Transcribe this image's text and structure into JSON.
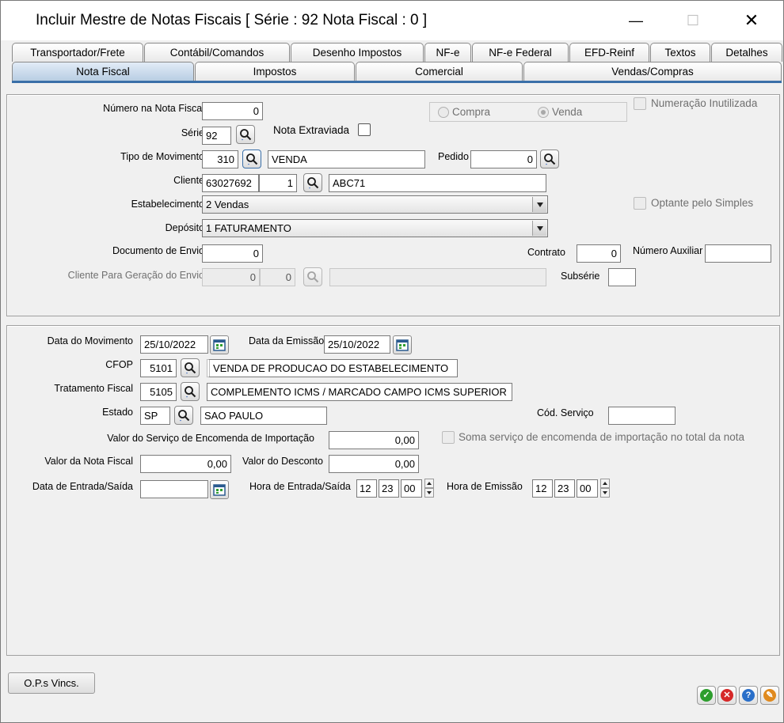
{
  "window": {
    "title": "Incluir Mestre de Notas Fiscais [ Série : 92 Nota Fiscal : 0 ]",
    "min_glyph": "—",
    "max_glyph": "☐",
    "close_glyph": "✕"
  },
  "tabs_row1": [
    "Transportador/Frete",
    "Contábil/Comandos",
    "Desenho Impostos",
    "NF-e",
    "NF-e Federal",
    "EFD-Reinf",
    "Textos",
    "Detalhes"
  ],
  "tabs_row2": [
    "Nota Fiscal",
    "Impostos",
    "Comercial",
    "Vendas/Compras"
  ],
  "active_tab": "Nota Fiscal",
  "top": {
    "numero_label": "Número na Nota Fiscal",
    "numero_value": "0",
    "serie_label": "Série",
    "serie_value": "92",
    "nota_extraviada_label": "Nota Extraviada",
    "tipo_mov_label": "Tipo de Movimento",
    "tipo_mov_code": "310",
    "tipo_mov_desc": "VENDA",
    "pedido_label": "Pedido",
    "pedido_value": "0",
    "cliente_label": "Cliente",
    "cliente_code": "63027692",
    "cliente_seq": "1",
    "cliente_name": "ABC71",
    "estab_label": "Estabelecimento",
    "estab_value": "2 Vendas",
    "deposito_label": "Depósito",
    "deposito_value": "1 FATURAMENTO",
    "doc_envio_label": "Documento de Envio",
    "doc_envio_value": "0",
    "contrato_label": "Contrato",
    "contrato_value": "0",
    "num_aux_label": "Número Auxiliar",
    "num_aux_value": "",
    "cliente_ger_label": "Cliente Para Geração do Envio",
    "cliente_ger_code": "0",
    "cliente_ger_seq": "0",
    "cliente_ger_name": "",
    "subserie_label": "Subsérie",
    "subserie_value": "",
    "compra_label": "Compra",
    "venda_label": "Venda",
    "selected_radio": "Venda",
    "num_inutilizada_label": "Numeração Inutilizada",
    "optante_label": "Optante pelo Simples"
  },
  "bottom": {
    "data_mov_label": "Data do Movimento",
    "data_mov_value": "25/10/2022",
    "data_emissao_label": "Data da Emissão",
    "data_emissao_value": "25/10/2022",
    "cfop_label": "CFOP",
    "cfop_code": "5101",
    "cfop_desc": "VENDA DE PRODUCAO DO ESTABELECIMENTO",
    "trat_label": "Tratamento Fiscal",
    "trat_code": "5105",
    "trat_desc": "COMPLEMENTO ICMS / MARCADO CAMPO ICMS SUPERIOR",
    "estado_label": "Estado",
    "estado_code": "SP",
    "estado_name": "SAO PAULO",
    "cod_servico_label": "Cód. Serviço",
    "cod_servico_value": "",
    "valor_serv_label": "Valor do Serviço de Encomenda de Importação",
    "valor_serv_value": "0,00",
    "soma_label": "Soma serviço de encomenda de importação no total da nota",
    "valor_nf_label": "Valor da Nota Fiscal",
    "valor_nf_value": "0,00",
    "valor_desc_label": "Valor do Desconto",
    "valor_desc_value": "0,00",
    "data_entrada_label": "Data de Entrada/Saída",
    "data_entrada_value": "",
    "hora_entrada_label": "Hora de Entrada/Saída",
    "hora_entrada": [
      "12",
      "23",
      "00"
    ],
    "hora_emissao_label": "Hora de Emissão",
    "hora_emissao": [
      "12",
      "23",
      "00"
    ]
  },
  "footer": {
    "ops_button": "O.P.s Vincs.",
    "ok_icon": "check-icon",
    "cancel_icon": "x-icon",
    "help_icon": "question-icon",
    "tools_icon": "wrench-icon",
    "colors": {
      "ok": "#2e9e2e",
      "cancel": "#d62828",
      "help": "#2a6fc9",
      "tools": "#e08a1e"
    }
  }
}
